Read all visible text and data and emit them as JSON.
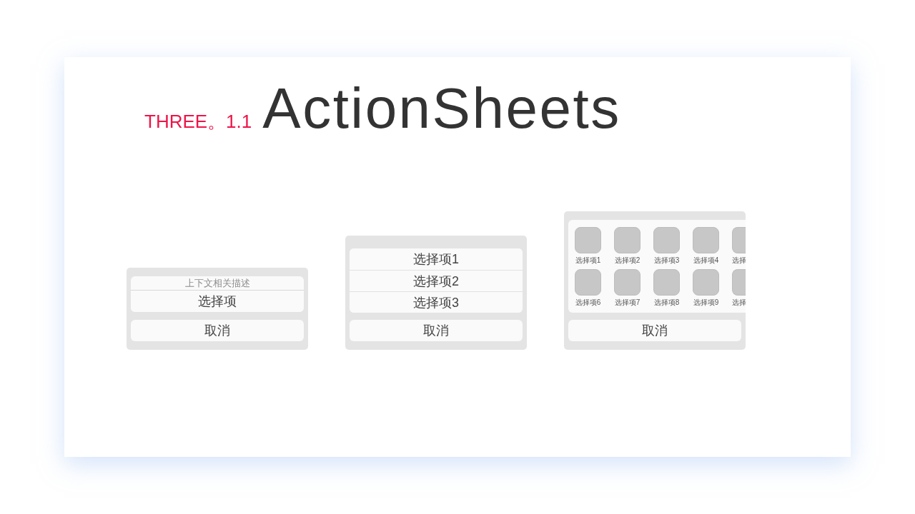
{
  "title": {
    "section": "THREE。1.1",
    "heading": "ActionSheets"
  },
  "sheets": [
    {
      "kind": "list",
      "header": "上下文相关描述",
      "items": [
        "选择项"
      ],
      "cancel": "取消"
    },
    {
      "kind": "list",
      "items": [
        "选择项1",
        "选择项2",
        "选择项3"
      ],
      "cancel": "取消"
    },
    {
      "kind": "grid",
      "items": [
        "选择项1",
        "选择项2",
        "选择项3",
        "选择项4",
        "选择",
        "选择项6",
        "选择项7",
        "选择项8",
        "选择项9",
        "选择"
      ],
      "cancel": "取消"
    }
  ]
}
